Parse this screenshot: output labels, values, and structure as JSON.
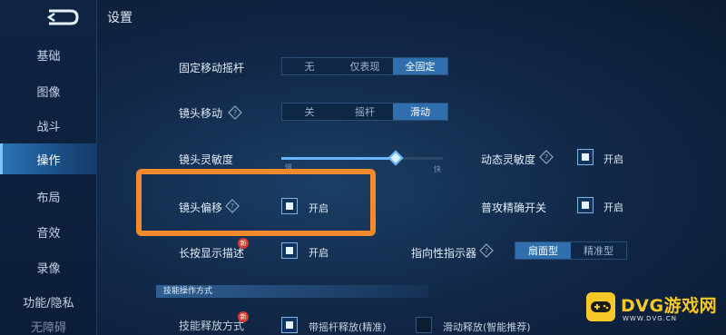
{
  "page_title": "设置",
  "sidebar": {
    "items": [
      {
        "label": "基础"
      },
      {
        "label": "图像"
      },
      {
        "label": "战斗"
      },
      {
        "label": "操作",
        "active": true
      },
      {
        "label": "布局"
      },
      {
        "label": "音效"
      },
      {
        "label": "录像"
      },
      {
        "label": "功能/隐私"
      },
      {
        "label": "无障碍"
      }
    ]
  },
  "settings": {
    "joystick": {
      "label": "固定移动摇杆",
      "options": [
        "无",
        "仅表现",
        "全固定"
      ],
      "selected": "全固定"
    },
    "camera_move": {
      "label": "镜头移动",
      "options": [
        "关",
        "摇杆",
        "滑动"
      ],
      "selected": "滑动"
    },
    "camera_sensitivity": {
      "label": "镜头灵敏度",
      "min_label": "慢",
      "max_label": "快",
      "level": 0.71
    },
    "dynamic_sensitivity": {
      "label": "动态灵敏度",
      "checked": true,
      "toggle_label": "开启"
    },
    "camera_offset": {
      "label": "镜头偏移",
      "checked": true,
      "toggle_label": "开启"
    },
    "precise_attack": {
      "label": "普攻精确开关",
      "checked": true,
      "toggle_label": "开启"
    },
    "long_press_desc": {
      "label": "长按显示描述",
      "badge": "新",
      "checked": true,
      "toggle_label": "开启"
    },
    "direction_indicator": {
      "label": "指向性指示器",
      "options": [
        "扇面型",
        "精准型"
      ],
      "selected": "扇面型"
    },
    "section_skill": {
      "label": "技能操作方式"
    },
    "skill_release": {
      "label": "技能释放方式",
      "badge": "新",
      "option_a": "带摇杆释放(精准)",
      "option_b": "滑动释放(智能推荐)"
    }
  },
  "watermark": {
    "title": "DVG游戏网",
    "url": "WWW.DVG.CN"
  },
  "colors": {
    "accent": "#2f6fae",
    "highlight_box": "#f08a2c",
    "badge": "#d53a2e",
    "watermark": "#f6c928"
  }
}
